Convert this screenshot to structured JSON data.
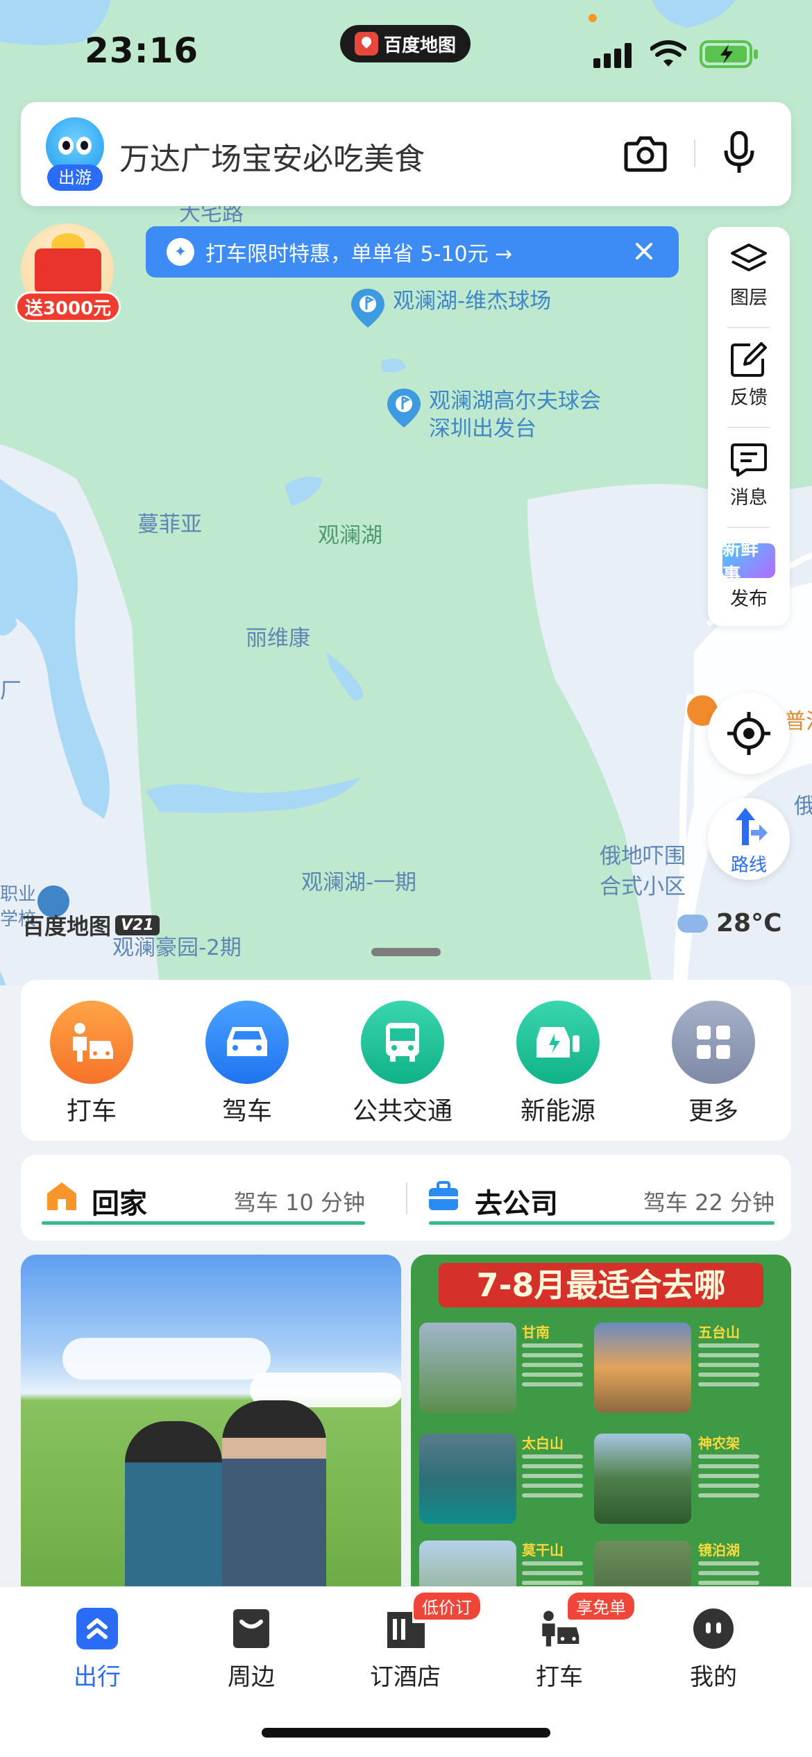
{
  "status_bar": {
    "time": "23:16",
    "app_pill": "百度地图"
  },
  "search": {
    "placeholder": "万达广场宝安必吃美食",
    "mascot_tag": "出游"
  },
  "promo_banner": {
    "text": "打车限时特惠，单单省 5-10元 →"
  },
  "red_packet": {
    "label": "送3000元"
  },
  "map": {
    "labels": [
      {
        "text": "大宅路",
        "style": "blue"
      },
      {
        "text": "蔓菲亚",
        "style": "blue"
      },
      {
        "text": "观澜湖",
        "style": "green"
      },
      {
        "text": "丽维康",
        "style": "blue"
      },
      {
        "text": "观澜湖-一期",
        "style": "blue"
      },
      {
        "text": "俄地吓围",
        "style": "blue"
      },
      {
        "text": "合式小区",
        "style": "blue"
      },
      {
        "text": "观澜豪园-2期",
        "style": "blue"
      },
      {
        "text": "俄",
        "style": "blue"
      },
      {
        "text": "厂",
        "style": "blue"
      },
      {
        "text": "职业",
        "style": "blue"
      },
      {
        "text": "学校",
        "style": "blue"
      },
      {
        "text": "普洱",
        "style": "orange"
      }
    ],
    "pois": [
      {
        "line1": "观澜湖-维杰球场",
        "line2": ""
      },
      {
        "line1": "观澜湖高尔夫球会",
        "line2": "深圳出发台"
      }
    ]
  },
  "toolbar": [
    {
      "icon": "layers-icon",
      "label": "图层"
    },
    {
      "icon": "feedback-icon",
      "label": "反馈"
    },
    {
      "icon": "message-icon",
      "label": "消息"
    },
    {
      "icon": "xinxianshi-icon",
      "label": "发布",
      "badge": "新鲜事"
    }
  ],
  "route_button": {
    "label": "路线"
  },
  "weather": {
    "temperature": "28°C"
  },
  "watermark": {
    "brand": "百度地图",
    "version": "V21"
  },
  "quick_actions": [
    {
      "label": "打车",
      "color": "#f6822a"
    },
    {
      "label": "驾车",
      "color": "#2f86f6"
    },
    {
      "label": "公共交通",
      "color": "#1fc29a"
    },
    {
      "label": "新能源",
      "color": "#1fc29a"
    },
    {
      "label": "更多",
      "color": "#8e9ab3"
    }
  ],
  "commute": {
    "home": {
      "title": "回家",
      "eta": "驾车 10 分钟"
    },
    "work": {
      "title": "去公司",
      "eta": "驾车 22 分钟"
    }
  },
  "feed": {
    "poster_title": "7-8月最适合去哪",
    "poster_places": [
      "甘南",
      "五台山",
      "太白山",
      "神农架",
      "莫干山",
      "镜泊湖"
    ]
  },
  "tabbar": [
    {
      "label": "出行",
      "active": true,
      "badge": ""
    },
    {
      "label": "周边",
      "active": false,
      "badge": ""
    },
    {
      "label": "订酒店",
      "active": false,
      "badge": "低价订"
    },
    {
      "label": "打车",
      "active": false,
      "badge": "享免单"
    },
    {
      "label": "我的",
      "active": false,
      "badge": ""
    }
  ],
  "colors": {
    "accent": "#2a6cf6",
    "map_green": "#bfe9cf",
    "water": "#a9d8f5",
    "banner": "#3d8bf5"
  }
}
